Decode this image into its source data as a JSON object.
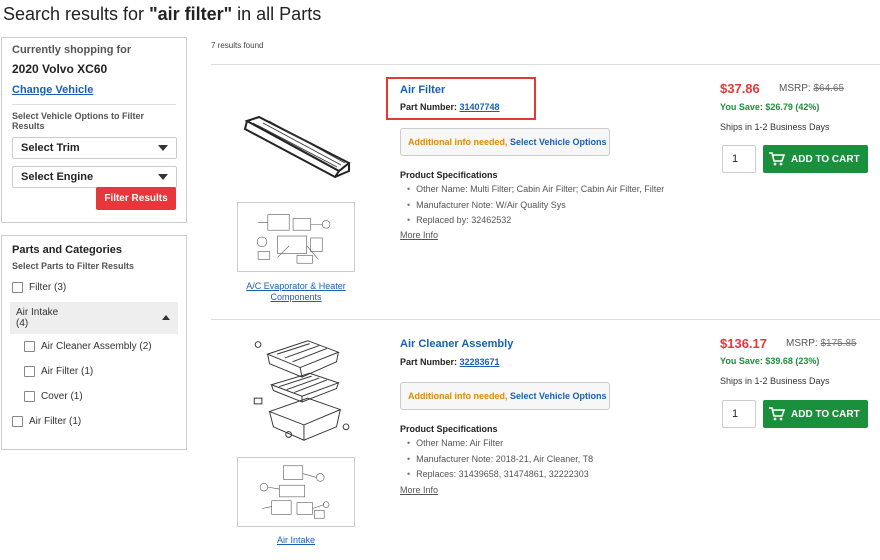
{
  "page": {
    "title_prefix": "Search results for ",
    "query": "\"air filter\"",
    "title_suffix": " in all Parts"
  },
  "vehicle": {
    "label": "Currently shopping for",
    "name": "2020 Volvo XC60",
    "change_link": "Change Vehicle",
    "options_label": "Select Vehicle Options to Filter Results",
    "trim_select": "Select Trim",
    "engine_select": "Select Engine",
    "filter_button": "Filter Results"
  },
  "categories": {
    "title": "Parts and Categories",
    "subtitle": "Select Parts to Filter Results",
    "items": [
      {
        "label": "Filter (3)"
      },
      {
        "label": "Air Intake",
        "count": "(4)"
      },
      {
        "label": "Air Cleaner Assembly (2)"
      },
      {
        "label": "Air Filter (1)"
      },
      {
        "label": "Cover (1)"
      },
      {
        "label": "Air Filter (1)"
      }
    ]
  },
  "results": {
    "count_text": "7 results found",
    "products": [
      {
        "name": "Air Filter",
        "part_label": "Part Number: ",
        "part_number": "31407748",
        "info_needed": "Additional info needed,",
        "select_options": "Select Vehicle Options",
        "spec_title": "Product Specifications",
        "specs": [
          "Other Name: Multi Filter; Cabin Air Filter; Cabin Air Filter, Filter",
          "Manufacturer Note: W/Air Quality Sys",
          "Replaced by: 32462532"
        ],
        "more_info": "More Info",
        "diagram_link": "A/C Evaporator & Heater Components",
        "price": "$37.86",
        "msrp_label": "MSRP: ",
        "msrp": "$64.65",
        "save": "You Save: $26.79 (42%)",
        "ships": "Ships in 1-2 Business Days",
        "qty": "1",
        "cart": "ADD TO CART"
      },
      {
        "name": "Air Cleaner Assembly",
        "part_label": "Part Number: ",
        "part_number": "32283671",
        "info_needed": "Additional info needed,",
        "select_options": "Select Vehicle Options",
        "spec_title": "Product Specifications",
        "specs": [
          "Other Name: Air Filter",
          "Manufacturer Note: 2018-21, Air Cleaner, T8",
          "Replaces: 31439658, 31474861, 32222303"
        ],
        "more_info": "More Info",
        "diagram_link": "Air Intake",
        "price": "$136.17",
        "msrp_label": "MSRP: ",
        "msrp": "$175.85",
        "save": "You Save: $39.68 (23%)",
        "ships": "Ships in 1-2 Business Days",
        "qty": "1",
        "cart": "ADD TO CART"
      }
    ]
  },
  "colors": {
    "link_blue": "#1a5fb4",
    "price_red": "#e8363a",
    "save_green": "#1a8f3c",
    "info_orange": "#e08a00",
    "highlight_red": "#e53935"
  },
  "icons": [
    "caret-down-icon",
    "caret-up-icon",
    "cart-icon"
  ]
}
